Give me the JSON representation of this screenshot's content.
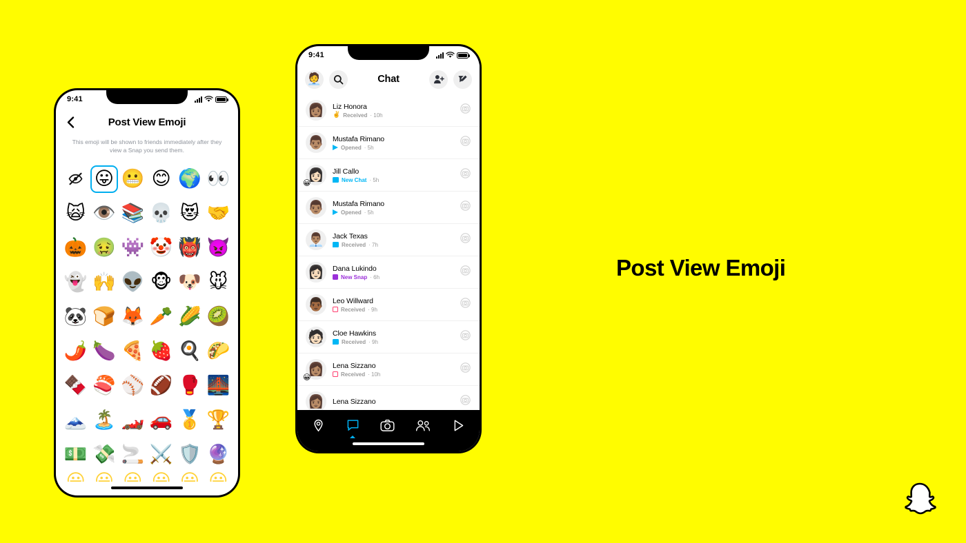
{
  "page": {
    "background_color": "#FFFC00",
    "caption": "Post View Emoji",
    "logo_icon": "snapchat-ghost-logo"
  },
  "left_phone": {
    "status_bar": {
      "time": "9:41",
      "signal_icon": "cellular-bars-icon",
      "wifi_icon": "wifi-icon",
      "battery_icon": "battery-full-icon"
    },
    "header": {
      "back_icon": "chevron-left-icon",
      "title": "Post View Emoji"
    },
    "subtitle": "This emoji will be shown to friends immediately after they view a Snap you send them.",
    "selection": {
      "selected_index": 1,
      "highlight_color": "#00AEEF"
    },
    "emoji_grid": {
      "columns": 6,
      "rows": [
        [
          {
            "glyph": "",
            "name": "hide-emoji-icon",
            "is_icon": true
          },
          {
            "glyph": "😛",
            "name": "emoji-tongue-out"
          },
          {
            "glyph": "😬",
            "name": "emoji-grimacing"
          },
          {
            "glyph": "😊",
            "name": "emoji-smiling-eyes"
          },
          {
            "glyph": "🌍",
            "name": "emoji-globe"
          },
          {
            "glyph": "👀",
            "name": "emoji-eyes"
          }
        ],
        [
          {
            "glyph": "🙀",
            "name": "emoji-weary-cat"
          },
          {
            "glyph": "👁️",
            "name": "emoji-eye"
          },
          {
            "glyph": "📚",
            "name": "emoji-books"
          },
          {
            "glyph": "💀",
            "name": "emoji-skull"
          },
          {
            "glyph": "😻",
            "name": "emoji-heart-eyes-cat"
          },
          {
            "glyph": "🤝",
            "name": "emoji-handshake"
          }
        ],
        [
          {
            "glyph": "🎃",
            "name": "emoji-jack-o-lantern"
          },
          {
            "glyph": "🤢",
            "name": "emoji-nauseated"
          },
          {
            "glyph": "👾",
            "name": "emoji-alien-monster"
          },
          {
            "glyph": "🤡",
            "name": "emoji-clown"
          },
          {
            "glyph": "👹",
            "name": "emoji-ogre"
          },
          {
            "glyph": "👿",
            "name": "emoji-angry-devil"
          }
        ],
        [
          {
            "glyph": "👻",
            "name": "emoji-ghost"
          },
          {
            "glyph": "🙌",
            "name": "emoji-raising-hands"
          },
          {
            "glyph": "👽",
            "name": "emoji-alien"
          },
          {
            "glyph": "🐵",
            "name": "emoji-monkey-face"
          },
          {
            "glyph": "🐶",
            "name": "emoji-dog-face"
          },
          {
            "glyph": "🐭",
            "name": "emoji-mouse-face"
          }
        ],
        [
          {
            "glyph": "🐼",
            "name": "emoji-panda"
          },
          {
            "glyph": "🍞",
            "name": "emoji-bread"
          },
          {
            "glyph": "🦊",
            "name": "emoji-fox"
          },
          {
            "glyph": "🥕",
            "name": "emoji-carrot"
          },
          {
            "glyph": "🌽",
            "name": "emoji-corn"
          },
          {
            "glyph": "🥝",
            "name": "emoji-kiwi"
          }
        ],
        [
          {
            "glyph": "🌶️",
            "name": "emoji-hot-pepper"
          },
          {
            "glyph": "🍆",
            "name": "emoji-eggplant"
          },
          {
            "glyph": "🍕",
            "name": "emoji-pizza"
          },
          {
            "glyph": "🍓",
            "name": "emoji-strawberry"
          },
          {
            "glyph": "🍳",
            "name": "emoji-cooking-egg"
          },
          {
            "glyph": "🌮",
            "name": "emoji-taco"
          }
        ],
        [
          {
            "glyph": "🍫",
            "name": "emoji-chocolate-bar"
          },
          {
            "glyph": "🍣",
            "name": "emoji-sushi"
          },
          {
            "glyph": "⚾",
            "name": "emoji-baseball"
          },
          {
            "glyph": "🏈",
            "name": "emoji-football"
          },
          {
            "glyph": "🥊",
            "name": "emoji-boxing-glove"
          },
          {
            "glyph": "🌉",
            "name": "emoji-bridge-at-night"
          }
        ],
        [
          {
            "glyph": "🗻",
            "name": "emoji-mount-fuji"
          },
          {
            "glyph": "🏝️",
            "name": "emoji-desert-island"
          },
          {
            "glyph": "🏎️",
            "name": "emoji-racing-car"
          },
          {
            "glyph": "🚗",
            "name": "emoji-automobile"
          },
          {
            "glyph": "🥇",
            "name": "emoji-gold-medal"
          },
          {
            "glyph": "🏆",
            "name": "emoji-trophy"
          }
        ],
        [
          {
            "glyph": "💵",
            "name": "emoji-dollar-banknote"
          },
          {
            "glyph": "💸",
            "name": "emoji-money-with-wings"
          },
          {
            "glyph": "🚬",
            "name": "emoji-cigarette"
          },
          {
            "glyph": "⚔️",
            "name": "emoji-crossed-swords"
          },
          {
            "glyph": "🛡️",
            "name": "emoji-shield"
          },
          {
            "glyph": "🔮",
            "name": "emoji-crystal-ball"
          }
        ],
        [
          {
            "glyph": "😀",
            "name": "emoji-partial-1"
          },
          {
            "glyph": "😀",
            "name": "emoji-partial-2"
          },
          {
            "glyph": "😀",
            "name": "emoji-partial-3"
          },
          {
            "glyph": "😀",
            "name": "emoji-partial-4"
          },
          {
            "glyph": "😀",
            "name": "emoji-partial-5"
          },
          {
            "glyph": "😀",
            "name": "emoji-partial-6"
          }
        ]
      ]
    }
  },
  "right_phone": {
    "status_bar": {
      "time": "9:41",
      "signal_icon": "cellular-bars-icon",
      "wifi_icon": "wifi-icon",
      "battery_icon": "battery-full-icon"
    },
    "header": {
      "avatar_icon": "profile-bitmoji-avatar",
      "avatar_glyph": "🧑‍💼",
      "search_icon": "search-icon",
      "title": "Chat",
      "add_friend_icon": "add-friend-icon",
      "compose_icon": "compose-new-chat-icon"
    },
    "conversations": [
      {
        "name": "Liz Honora",
        "avatar": "👩🏽",
        "badge": "",
        "status": "Received",
        "time": "10h",
        "icon": "hand-emoji",
        "icon_color": "#F2C94C",
        "status_color": "#9a9a9a"
      },
      {
        "name": "Mustafa Rimano",
        "avatar": "👨🏽",
        "badge": "",
        "status": "Opened",
        "time": "5h",
        "icon": "sent-arrow-icon",
        "icon_color": "#00B7F5",
        "status_color": "#9a9a9a"
      },
      {
        "name": "Jill Callo",
        "avatar": "👩🏻",
        "badge": "😀",
        "status": "New Chat",
        "time": "5h",
        "icon": "chat-filled-icon",
        "icon_color": "#00B7F5",
        "status_color": "#00B7F5"
      },
      {
        "name": "Mustafa Rimano",
        "avatar": "👨🏽",
        "badge": "",
        "status": "Opened",
        "time": "5h",
        "icon": "sent-arrow-icon",
        "icon_color": "#00B7F5",
        "status_color": "#9a9a9a"
      },
      {
        "name": "Jack Texas",
        "avatar": "👨🏽‍💼",
        "badge": "",
        "status": "Received",
        "time": "7h",
        "icon": "chat-outline-cyan-icon",
        "icon_color": "#00B7F5",
        "status_color": "#9a9a9a"
      },
      {
        "name": "Dana Lukindo",
        "avatar": "👩🏻",
        "badge": "",
        "status": "New Snap",
        "time": "6h",
        "icon": "snap-filled-purple-icon",
        "icon_color": "#9B30D9",
        "status_color": "#9B30D9"
      },
      {
        "name": "Leo Willward",
        "avatar": "👨🏾",
        "badge": "",
        "status": "Received",
        "time": "9h",
        "icon": "snap-outline-pink-icon",
        "icon_color": "#FF3C6E",
        "status_color": "#9a9a9a"
      },
      {
        "name": "Cloe Hawkins",
        "avatar": "🧑🏻",
        "badge": "",
        "status": "Received",
        "time": "9h",
        "icon": "chat-outline-cyan-icon",
        "icon_color": "#00B7F5",
        "status_color": "#9a9a9a"
      },
      {
        "name": "Lena Sizzano",
        "avatar": "👩🏽",
        "badge": "😀",
        "status": "Received",
        "time": "10h",
        "icon": "snap-outline-pink-icon",
        "icon_color": "#FF3C6E",
        "status_color": "#9a9a9a"
      },
      {
        "name": "Lena Sizzano",
        "avatar": "👩🏽",
        "badge": "",
        "status": "",
        "time": "",
        "icon": "",
        "icon_color": "#FF3C6E",
        "status_color": "#9a9a9a"
      }
    ],
    "row_camera_icon": "camera-circle-icon",
    "nav_bar": {
      "background_color": "#000000",
      "active_color": "#00AEEF",
      "items": [
        {
          "name": "nav-map",
          "icon": "location-pin-icon",
          "active": false
        },
        {
          "name": "nav-chat",
          "icon": "chat-bubble-icon",
          "active": true
        },
        {
          "name": "nav-camera",
          "icon": "camera-icon",
          "active": false
        },
        {
          "name": "nav-friends",
          "icon": "friends-icon",
          "active": false
        },
        {
          "name": "nav-stories",
          "icon": "play-triangle-icon",
          "active": false
        }
      ]
    }
  }
}
